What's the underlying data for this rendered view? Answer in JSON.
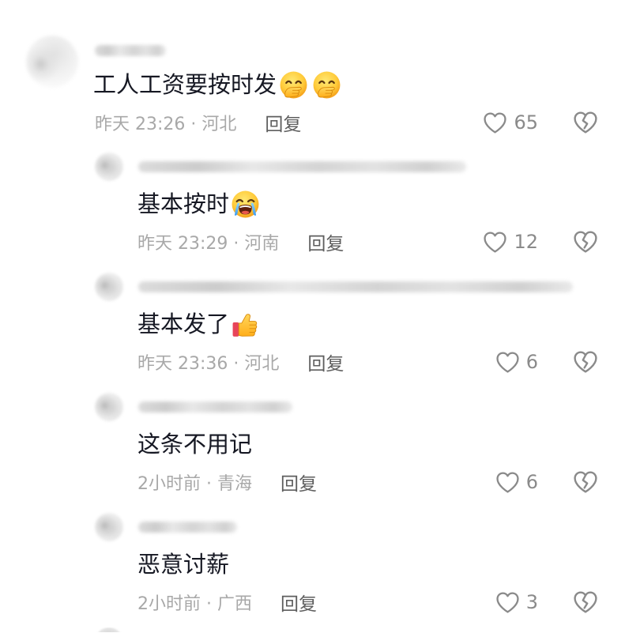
{
  "colors": {
    "text": "#161823",
    "meta": "#a8a8a8",
    "reply_action": "#5e5e5e",
    "count": "#8a8a8a",
    "icon": "#8a8a8a"
  },
  "icons": {
    "like": "heart-outline-icon",
    "dislike": "broken-heart-icon"
  },
  "comment": {
    "text": "工人工资要按时发",
    "emojis": [
      "face-with-hand-over-mouth-emoji",
      "face-with-hand-over-mouth-emoji"
    ],
    "meta": "昨天 23:26 · 河北",
    "reply_label": "回复",
    "likes": "65"
  },
  "replies": [
    {
      "text": "基本按时",
      "emojis": [
        "loudly-crying-face-emoji"
      ],
      "meta": "昨天 23:29 · 河南",
      "reply_label": "回复",
      "likes": "12"
    },
    {
      "text": "基本发了",
      "emojis": [
        "thumbs-up-emoji"
      ],
      "meta": "昨天 23:36 · 河北",
      "reply_label": "回复",
      "likes": "6"
    },
    {
      "text": "这条不用记",
      "emojis": [],
      "meta": "2小时前 · 青海",
      "reply_label": "回复",
      "likes": "6"
    },
    {
      "text": "恶意讨薪",
      "emojis": [],
      "meta": "2小时前 · 广西",
      "reply_label": "回复",
      "likes": "3"
    }
  ]
}
